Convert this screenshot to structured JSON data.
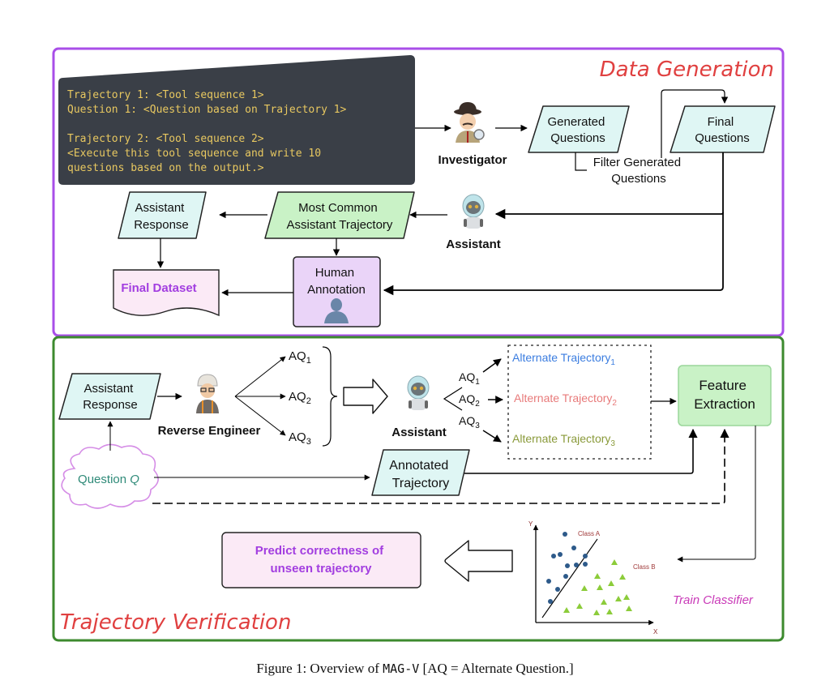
{
  "data_generation": {
    "title": "Data Generation",
    "prompt_lines": [
      "Trajectory 1: <Tool sequence 1>",
      "Question 1: <Question based on Trajectory 1>",
      "",
      "Trajectory 2: <Tool sequence 2>",
      "<Execute this tool sequence and write 10",
      "questions based on the output.>"
    ],
    "investigator_label": "Investigator",
    "generated_questions": [
      "Generated",
      "Questions"
    ],
    "final_questions": [
      "Final",
      "Questions"
    ],
    "filter_label": [
      "Filter Generated",
      "Questions"
    ],
    "assistant_label": "Assistant",
    "most_common": [
      "Most Common",
      "Assistant Trajectory"
    ],
    "assistant_response": [
      "Assistant",
      "Response"
    ],
    "human_annotation": [
      "Human",
      "Annotation"
    ],
    "final_dataset": "Final Dataset"
  },
  "trajectory_verification": {
    "title": "Trajectory Verification",
    "assistant_response": [
      "Assistant",
      "Response"
    ],
    "reverse_engineer_label": "Reverse Engineer",
    "aq_labels": [
      "AQ",
      "AQ",
      "AQ"
    ],
    "aq_subscripts": [
      "1",
      "2",
      "3"
    ],
    "assistant_label": "Assistant",
    "alternate_trajectories": [
      {
        "text": "Alternate Trajectory",
        "sub": "1",
        "color": "#3b7de0"
      },
      {
        "text": "Alternate Trajectory",
        "sub": "2",
        "color": "#e87a7a"
      },
      {
        "text": "Alternate Trajectory",
        "sub": "3",
        "color": "#8a9a3a"
      }
    ],
    "feature_extraction": [
      "Feature",
      "Extraction"
    ],
    "question_q": "Question ",
    "question_q_var": "Q",
    "annotated_trajectory": [
      "Annotated",
      "Trajectory"
    ],
    "predict": [
      "Predict correctness of",
      "unseen trajectory"
    ],
    "train_classifier": "Train Classifier",
    "classifier_plot": {
      "x_axis": "X",
      "y_axis": "Y",
      "class_a": "Class A",
      "class_b": "Class B"
    }
  },
  "caption": {
    "prefix": "Figure 1: Overview of ",
    "name": "MAG-V",
    "suffix": " [AQ = Alternate Question.]"
  },
  "colors": {
    "data_gen_border": "#a84ee8",
    "traj_border": "#3c8a2e",
    "title_red": "#e04040",
    "cyan_fill": "#dff6f4",
    "green_fill": "#c9f2c6",
    "purple_fill": "#ead4f8",
    "pink_fill": "#fbeaf6",
    "prompt_bg": "#3a3f47",
    "prompt_text": "#e8c860",
    "purple_text": "#a23ee0",
    "teal_text": "#2e8a78",
    "magenta_text": "#c93ab8"
  }
}
